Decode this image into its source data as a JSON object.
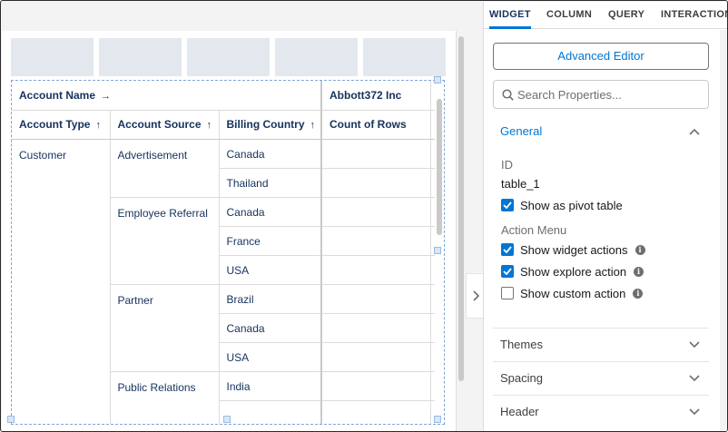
{
  "pivot": {
    "header_row1": {
      "account_name": "Account Name",
      "account_name_arrow": "→",
      "column_value": "Abbott372 Inc"
    },
    "header_row2": [
      {
        "label": "Account Type",
        "arrow": "↑"
      },
      {
        "label": "Account Source",
        "arrow": "↑"
      },
      {
        "label": "Billing Country",
        "arrow": "↑"
      },
      {
        "label": "Count of Rows",
        "arrow": ""
      }
    ],
    "account_type": "Customer",
    "groups": [
      {
        "source": "Advertisement",
        "countries": [
          "Canada",
          "Thailand"
        ]
      },
      {
        "source": "Employee Referral",
        "countries": [
          "Canada",
          "France",
          "USA"
        ]
      },
      {
        "source": "Partner",
        "countries": [
          "Brazil",
          "Canada",
          "USA"
        ]
      },
      {
        "source": "Public Relations",
        "countries": [
          "India",
          ""
        ]
      }
    ]
  },
  "panel": {
    "tabs": [
      "WIDGET",
      "COLUMN",
      "QUERY",
      "INTERACTION"
    ],
    "active_tab": "WIDGET",
    "advanced_editor": "Advanced Editor",
    "search_placeholder": "Search Properties...",
    "general": {
      "title": "General",
      "id_label": "ID",
      "id_value": "table_1",
      "show_pivot": {
        "label": "Show as pivot table",
        "checked": true
      },
      "action_menu_label": "Action Menu",
      "actions": [
        {
          "label": "Show widget actions",
          "checked": true
        },
        {
          "label": "Show explore action",
          "checked": true
        },
        {
          "label": "Show custom action",
          "checked": false
        }
      ]
    },
    "sections": [
      "Themes",
      "Spacing",
      "Header"
    ]
  },
  "colors": {
    "accent": "#0176d3",
    "header_text": "#16325c",
    "placeholder_block": "#e3e8ee",
    "selection_border": "#7ea6d6"
  },
  "icons": {
    "search": "search-icon",
    "chevron_up": "chevron-up-icon",
    "chevron_down": "chevron-down-icon",
    "chevron_right": "chevron-right-icon",
    "info": "info-icon",
    "check": "check-icon"
  }
}
